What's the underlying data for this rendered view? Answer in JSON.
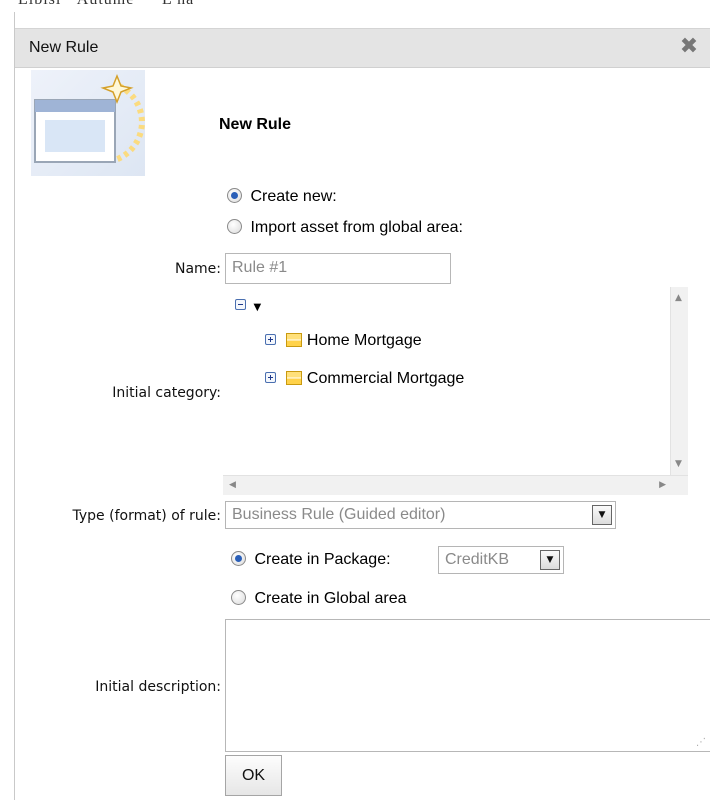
{
  "background_fragment": "Libisi · Autume · · L ha",
  "dialog": {
    "title": "New Rule",
    "heading": "New Rule",
    "close_icon": "close-x-icon",
    "source_options": {
      "create_new": "Create new:",
      "import_global": "Import asset from global area:",
      "selected": "create_new"
    },
    "name": {
      "label": "Name:",
      "value": "Rule #1"
    },
    "category": {
      "label": "Initial category:",
      "root_toggle": "minus",
      "items": [
        "Home Mortgage",
        "Commercial Mortgage"
      ]
    },
    "type": {
      "label": "Type (format) of rule:",
      "value": "Business Rule (Guided editor)"
    },
    "location_options": {
      "in_package": "Create in Package:",
      "package_value": "CreditKB",
      "in_global": "Create in Global area",
      "selected": "in_package"
    },
    "description": {
      "label": "Initial description:",
      "value": ""
    },
    "ok_label": "OK"
  },
  "colors": {
    "titlebar": "#e4e4e4",
    "radio_selected": "#2a5fb8",
    "category_icon": "#ffd24a"
  }
}
